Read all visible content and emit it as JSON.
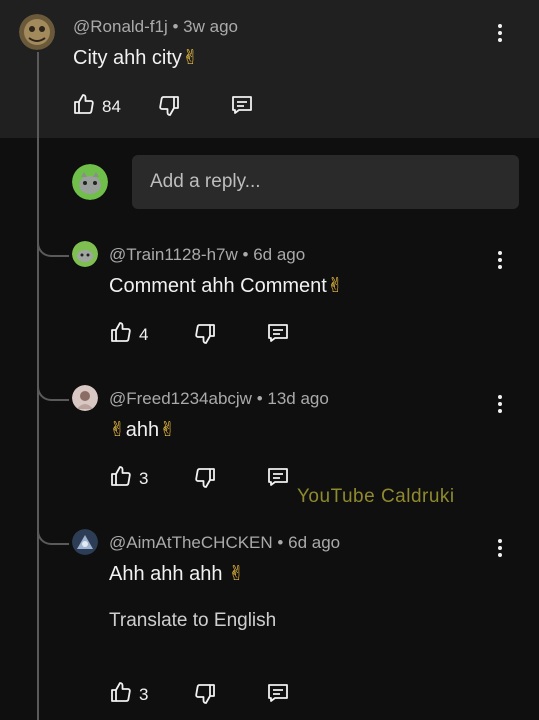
{
  "main_comment": {
    "handle": "@Ronald-f1j",
    "age": "3w ago",
    "text": "City ahh city",
    "emoji": "✌",
    "likes": "84"
  },
  "reply_input": {
    "placeholder": "Add a reply..."
  },
  "replies": [
    {
      "handle": "@Train1128-h7w",
      "age": "6d ago",
      "text": "Comment ahh Comment",
      "emoji": "✌",
      "likes": "4"
    },
    {
      "handle": "@Freed1234abcjw",
      "age": "13d ago",
      "text_prefix_emoji": "✌",
      "text": "ahh",
      "emoji": "✌",
      "likes": "3"
    },
    {
      "handle": "@AimAtTheCHCKEN",
      "age": "6d ago",
      "text": "Ahh ahh ahh ",
      "emoji": "✌",
      "likes": "3",
      "translate": "Translate to English"
    }
  ],
  "watermark": "YouTube Caldruki",
  "separator": "•",
  "icons": {
    "like": "thumbs-up-icon",
    "dislike": "thumbs-down-icon",
    "reply": "reply-comment-icon",
    "menu": "more-vertical-icon"
  }
}
